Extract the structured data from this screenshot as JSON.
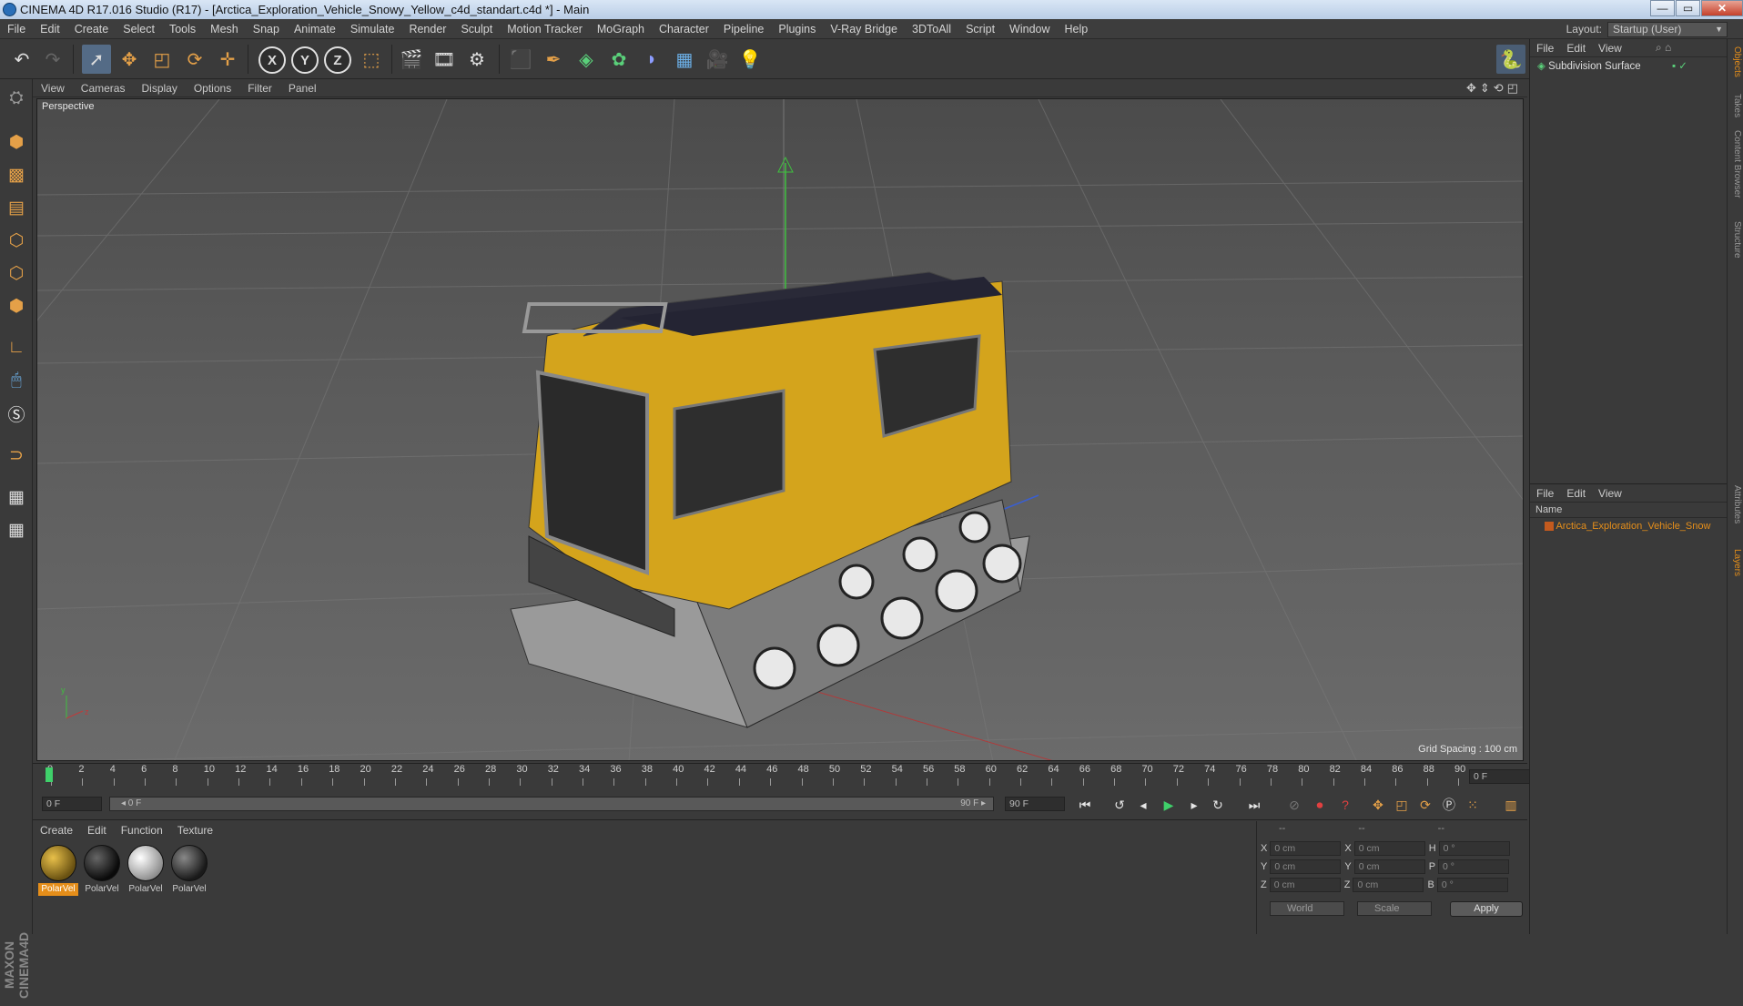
{
  "window": {
    "title": "CINEMA 4D R17.016 Studio (R17) - [Arctica_Exploration_Vehicle_Snowy_Yellow_c4d_standart.c4d *] - Main",
    "min": "—",
    "max": "▭",
    "close": "✕"
  },
  "menubar": {
    "items": [
      "File",
      "Edit",
      "Create",
      "Select",
      "Tools",
      "Mesh",
      "Snap",
      "Animate",
      "Simulate",
      "Render",
      "Sculpt",
      "Motion Tracker",
      "MoGraph",
      "Character",
      "Pipeline",
      "Plugins",
      "V-Ray Bridge",
      "3DToAll",
      "Script",
      "Window",
      "Help"
    ],
    "layout_label": "Layout:",
    "layout_value": "Startup (User)"
  },
  "toolbar": {
    "axis_x": "X",
    "axis_y": "Y",
    "axis_z": "Z"
  },
  "viewport": {
    "menu": [
      "View",
      "Cameras",
      "Display",
      "Options",
      "Filter",
      "Panel"
    ],
    "label": "Perspective",
    "grid_spacing": "Grid Spacing : 100 cm",
    "axis_y": "y",
    "axis_z": "z"
  },
  "timeline": {
    "ticks": [
      "0",
      "2",
      "4",
      "6",
      "8",
      "10",
      "12",
      "14",
      "16",
      "18",
      "20",
      "22",
      "24",
      "26",
      "28",
      "30",
      "32",
      "34",
      "36",
      "38",
      "40",
      "42",
      "44",
      "46",
      "48",
      "50",
      "52",
      "54",
      "56",
      "58",
      "60",
      "62",
      "64",
      "66",
      "68",
      "70",
      "72",
      "74",
      "76",
      "78",
      "80",
      "82",
      "84",
      "86",
      "88",
      "90"
    ],
    "current_frame": "0 F",
    "start_field": "0 F",
    "slider_start": "◂ 0 F",
    "slider_end": "90 F ▸",
    "end_field": "90 F",
    "end_field2": "90 F"
  },
  "materials": {
    "menu": [
      "Create",
      "Edit",
      "Function",
      "Texture"
    ],
    "items": [
      {
        "label": "PolarVel",
        "active": true
      },
      {
        "label": "PolarVel",
        "active": false
      },
      {
        "label": "PolarVel",
        "active": false
      },
      {
        "label": "PolarVel",
        "active": false
      }
    ]
  },
  "coords": {
    "header": [
      "--",
      "--",
      "--"
    ],
    "rows": [
      {
        "a": "X",
        "av": "0 cm",
        "b": "X",
        "bv": "0 cm",
        "c": "H",
        "cv": "0 °"
      },
      {
        "a": "Y",
        "av": "0 cm",
        "b": "Y",
        "bv": "0 cm",
        "c": "P",
        "cv": "0 °"
      },
      {
        "a": "Z",
        "av": "0 cm",
        "b": "Z",
        "bv": "0 cm",
        "c": "B",
        "cv": "0 °"
      }
    ],
    "world": "World",
    "scale": "Scale",
    "apply": "Apply"
  },
  "objects_panel": {
    "menu": [
      "File",
      "Edit",
      "View"
    ],
    "object": "Subdivision Surface"
  },
  "layers_panel": {
    "menu": [
      "File",
      "Edit",
      "View"
    ],
    "col_name": "Name",
    "item": "Arctica_Exploration_Vehicle_Snow"
  },
  "side_tabs": [
    "Objects",
    "Takes",
    "Content Browser",
    "Structure",
    "Attributes",
    "Layers"
  ]
}
